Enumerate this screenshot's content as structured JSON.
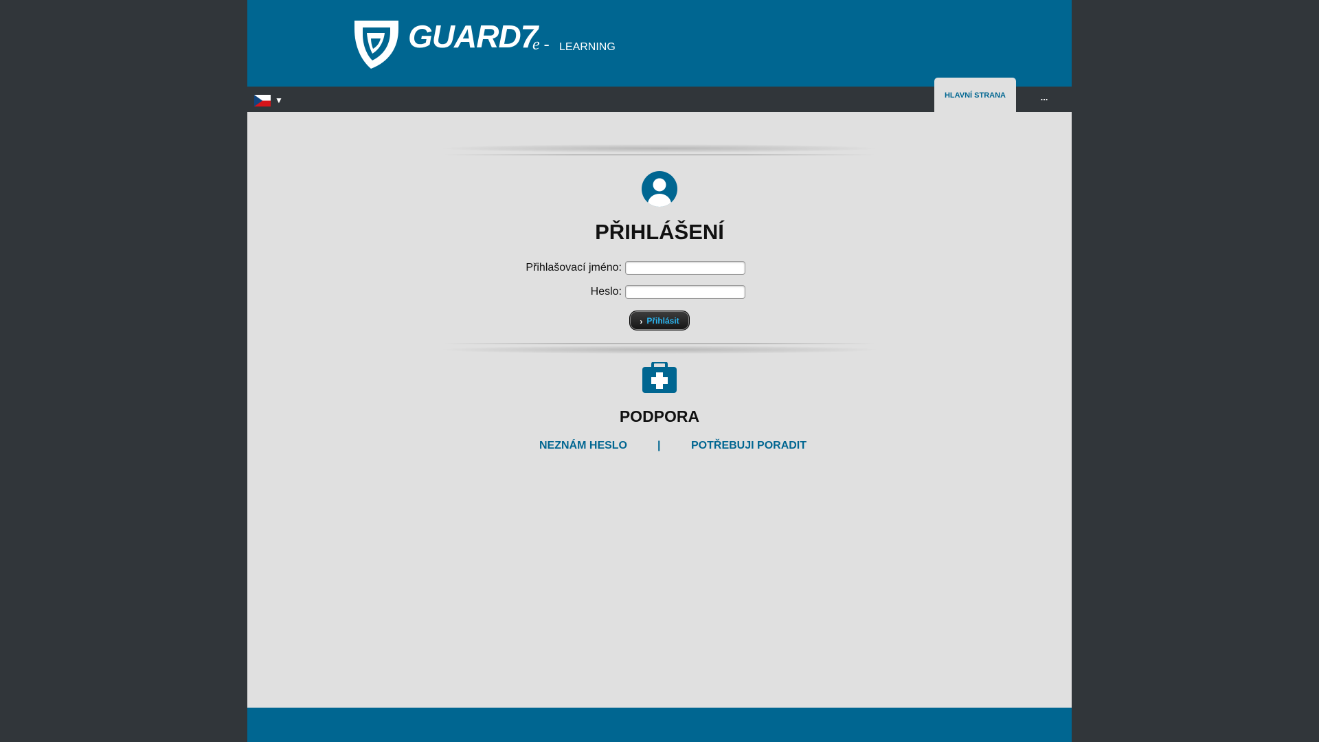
{
  "header": {
    "logo": {
      "name": "GUARD7",
      "e": "e -",
      "learning": "LEARNING"
    }
  },
  "nav": {
    "language": {
      "flag": "czech-flag",
      "caret": "▼"
    },
    "tabs": [
      {
        "label": "HLAVNÍ STRANA",
        "active": true
      },
      {
        "label": "..."
      }
    ]
  },
  "login": {
    "icon": "user-icon",
    "title": "PŘIHLÁŠENÍ",
    "username_label": "Přihlašovací jméno:",
    "username_value": "",
    "password_label": "Heslo:",
    "password_value": "",
    "submit_label": "Přihlásit"
  },
  "support": {
    "icon": "first-aid-icon",
    "title": "PODPORA",
    "links": [
      {
        "label": "NEZNÁM HESLO"
      },
      {
        "label": "|"
      },
      {
        "label": "POTŘEBUJI PORADIT"
      }
    ]
  },
  "colors": {
    "brand_blue": "#006691",
    "dark": "#31363a",
    "content_bg": "#e0e0e0",
    "button_text": "#2ab5f0"
  }
}
